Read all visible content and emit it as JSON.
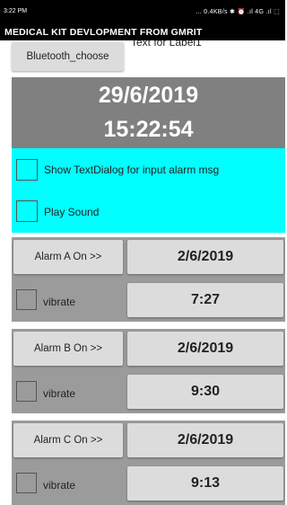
{
  "status_bar": {
    "time": "3:22 PM",
    "indicators": "... 0.4KB/s ✱ ⏰ .ıl 4G .ıl ⬚"
  },
  "app_bar": {
    "title": "MEDICAL KIT DEVLOPMENT FROM GMRIT"
  },
  "header": {
    "bluetooth_button": "Bluetooth_choose",
    "label1": "Text for Label1"
  },
  "datetime": {
    "date": "29/6/2019",
    "time": "15:22:54"
  },
  "options": {
    "show_textdialog_label": "Show TextDialog for input alarm msg",
    "play_sound_label": "Play Sound",
    "accent_color": "#00ffff"
  },
  "alarms": [
    {
      "button": "Alarm A On >>",
      "date": "2/6/2019",
      "vibrate_label": "vibrate",
      "time": "7:27"
    },
    {
      "button": "Alarm B On >>",
      "date": "2/6/2019",
      "vibrate_label": "vibrate",
      "time": "9:30"
    },
    {
      "button": "Alarm C On >>",
      "date": "2/6/2019",
      "vibrate_label": "vibrate",
      "time": "9:13"
    }
  ]
}
